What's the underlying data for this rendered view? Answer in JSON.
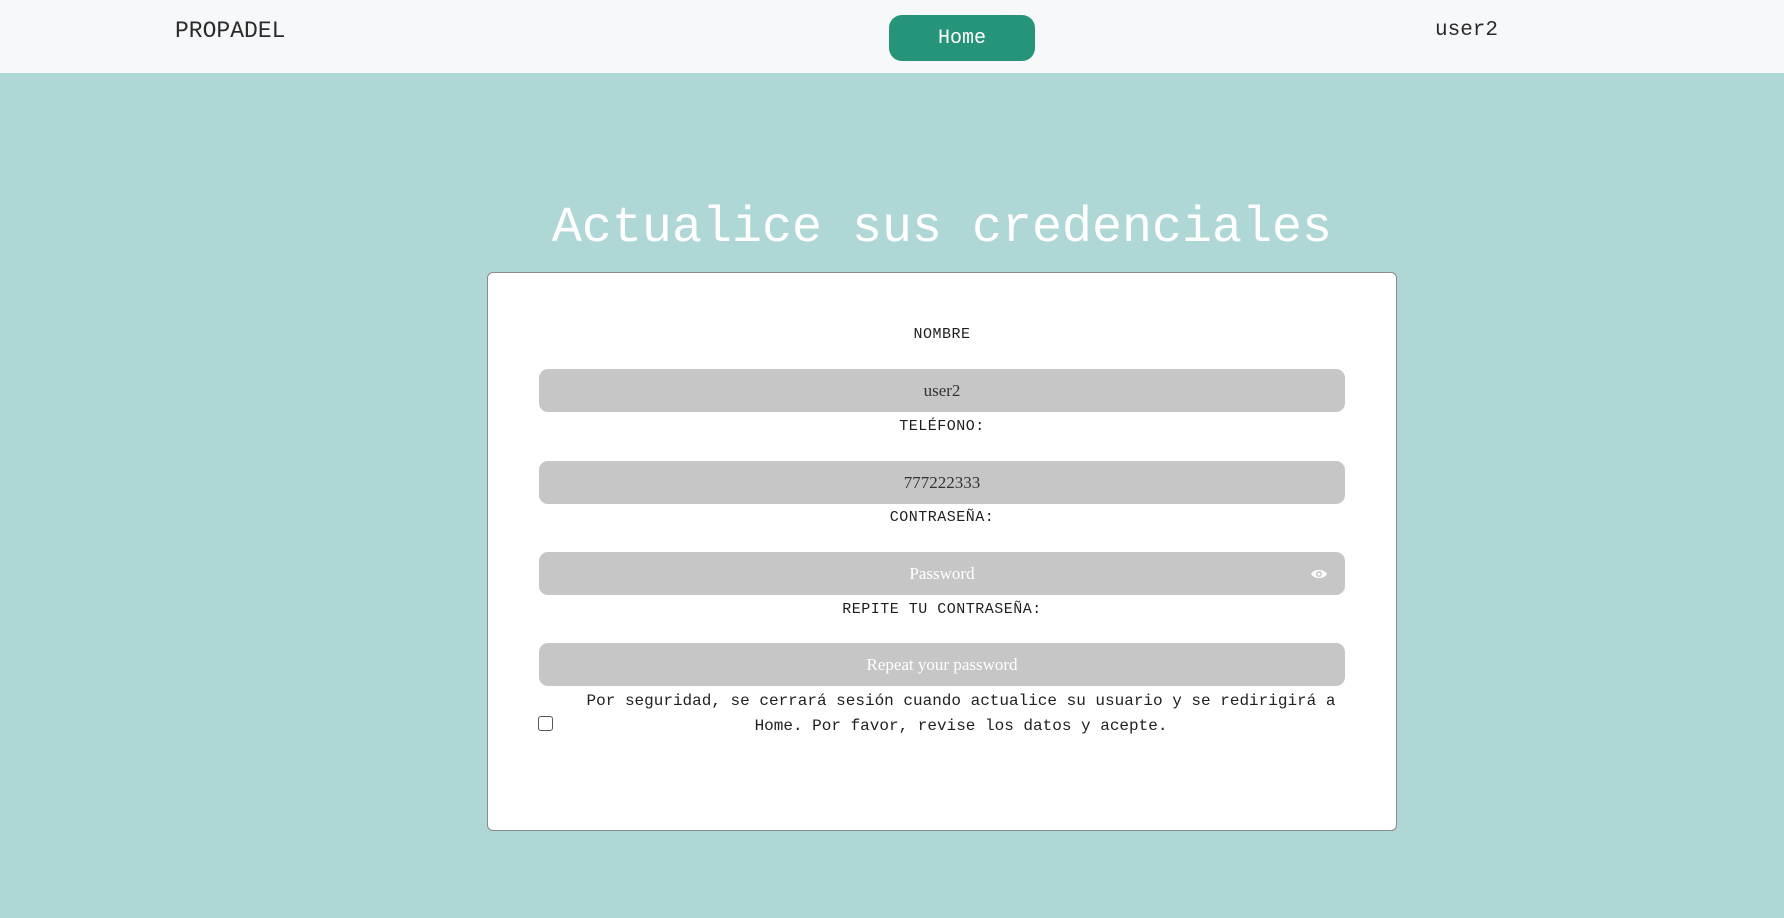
{
  "navbar": {
    "brand": "PROPADEL",
    "home_label": "Home",
    "user_label": "user2"
  },
  "page": {
    "title": "Actualice sus credenciales"
  },
  "form": {
    "name_label": "NOMBRE",
    "name_value": "user2",
    "phone_label": "TELÉFONO:",
    "phone_value": "777222333",
    "password_label": "CONTRASEÑA:",
    "password_placeholder": "Password",
    "repeat_label": "REPITE TU CONTRASEÑA:",
    "repeat_placeholder": "Repeat your password",
    "notice": "Por seguridad, se cerrará sesión cuando actualice su usuario y se redirigirá a Home. Por favor, revise los datos y acepte.",
    "accept_checked": false
  },
  "icons": {
    "password_toggle": "eye-icon"
  },
  "colors": {
    "background": "#afd7d5",
    "navbar": "#f7f8fa",
    "accent": "#259478",
    "field": "#c6c6c6"
  }
}
